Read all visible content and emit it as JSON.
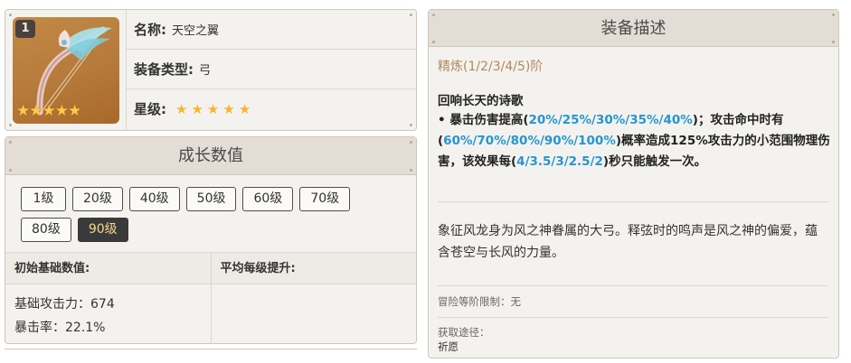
{
  "weapon": {
    "refine_badge": "1",
    "image_stars": "★★★★★",
    "name_label": "名称:",
    "name": "天空之翼",
    "type_label": "装备类型:",
    "type": "弓",
    "rarity_label": "星级:",
    "rarity": 5
  },
  "growth": {
    "title": "成长数值",
    "levels": [
      "1级",
      "20级",
      "40级",
      "50级",
      "60级",
      "70级",
      "80级",
      "90级"
    ],
    "selected_level": "90级",
    "table": {
      "col_base": "初始基础数值:",
      "col_avg": "平均每级提升:",
      "base_atk": "基础攻击力：674",
      "crit_rate": "暴击率：22.1%"
    }
  },
  "description": {
    "title": "装备描述",
    "refinement": "精炼(1/2/3/4/5)阶",
    "skill_name": "回响长天的诗歌",
    "skill_p1": "• 暴击伤害提高(",
    "skill_h1": "20%/25%/30%/35%/40%",
    "skill_p2": ")；攻击命中时有(",
    "skill_h2": "60%/70%/80%/90%/100%",
    "skill_p3": ")概率造成125%攻击力的小范围物理伤害，该效果每(",
    "skill_h3": "4/3.5/3/2.5/2",
    "skill_p4": ")秒只能触发一次。",
    "lore": "象征风龙身为风之神眷属的大弓。释弦时的鸣声是风之神的偏爱，蕴含苍空与长风的力量。",
    "adventure_limit": "冒险等阶限制：无",
    "source_label": "获取途径：",
    "source_value": "祈愿"
  },
  "colors": {
    "accent_blue": "#2596cf",
    "refine_gold": "#b08a5a",
    "star_gold": "#f6b62e",
    "active_level_bg": "#3a3a3a"
  }
}
